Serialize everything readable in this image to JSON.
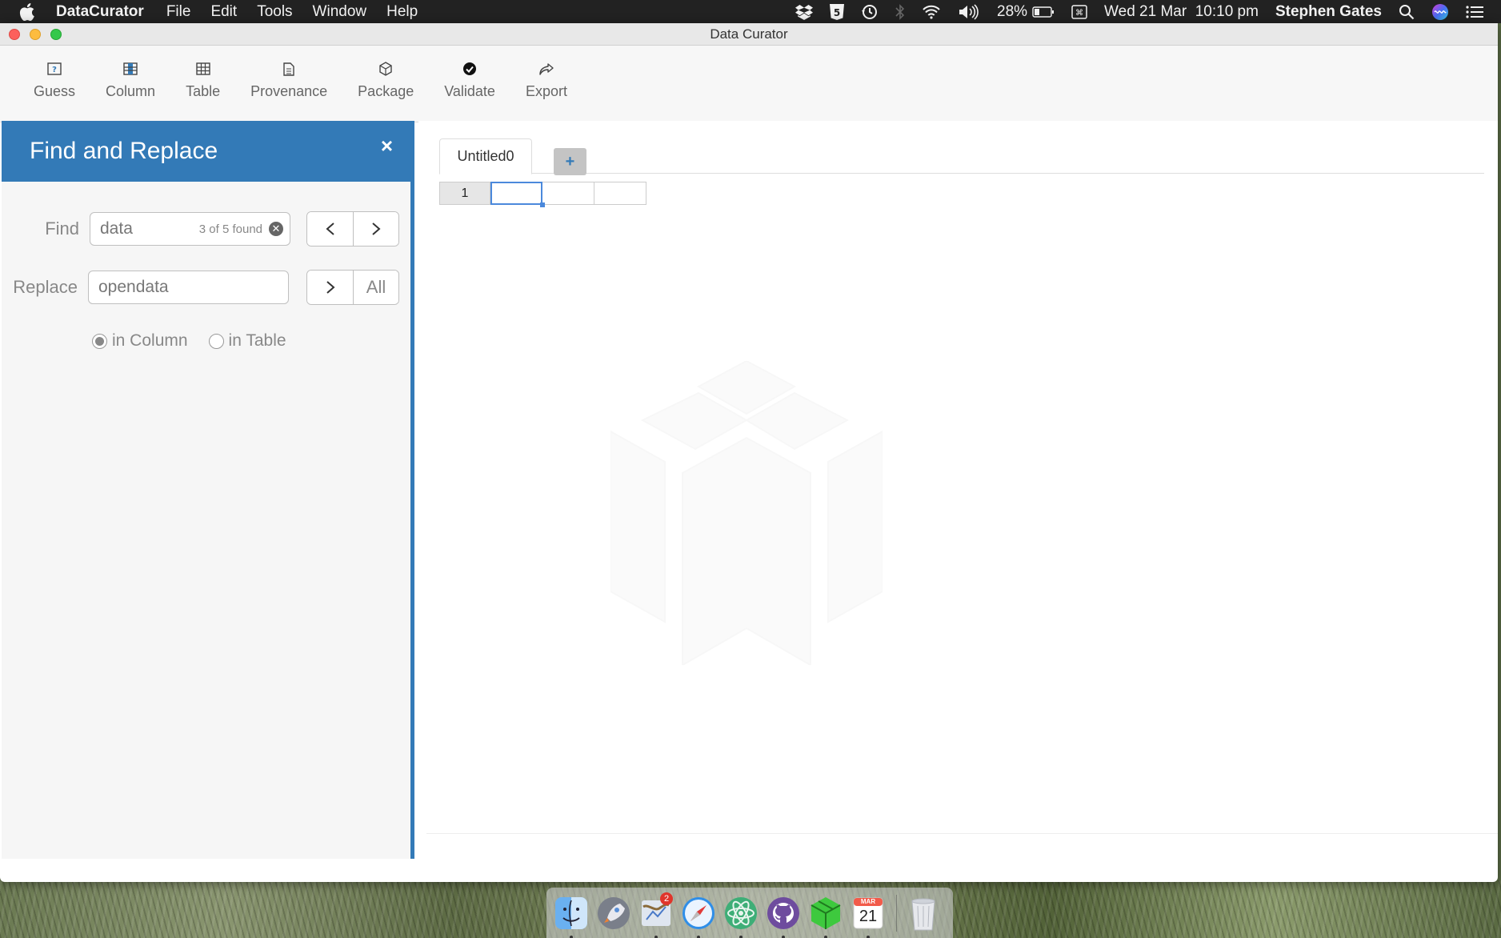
{
  "menubar": {
    "app_name": "DataCurator",
    "menus": [
      "File",
      "Edit",
      "Tools",
      "Window",
      "Help"
    ],
    "battery": "28%",
    "datetime": "Wed 21 Mar  10:10 pm",
    "user": "Stephen Gates"
  },
  "window": {
    "title": "Data Curator"
  },
  "toolbar": {
    "items": [
      {
        "label": "Guess",
        "icon": "guess-icon"
      },
      {
        "label": "Column",
        "icon": "column-icon"
      },
      {
        "label": "Table",
        "icon": "table-icon"
      },
      {
        "label": "Provenance",
        "icon": "document-icon"
      },
      {
        "label": "Package",
        "icon": "package-icon"
      },
      {
        "label": "Validate",
        "icon": "check-circle-icon"
      },
      {
        "label": "Export",
        "icon": "share-icon"
      }
    ]
  },
  "find_replace": {
    "title": "Find and Replace",
    "close": "×",
    "find_label": "Find",
    "find_value": "data",
    "find_count": "3 of 5 found",
    "replace_label": "Replace",
    "replace_value": "opendata",
    "prev_symbol": "<",
    "next_symbol": ">",
    "all_label": "All",
    "scope_options": [
      {
        "label": "in Column",
        "checked": true
      },
      {
        "label": "in Table",
        "checked": false
      }
    ]
  },
  "sheet": {
    "tabs": [
      {
        "label": "Untitled0",
        "active": true
      }
    ],
    "add_tab": "+",
    "row_numbers": [
      "1"
    ]
  },
  "dock": {
    "apps": [
      "finder",
      "launchpad",
      "mail",
      "safari",
      "atom",
      "github-desktop",
      "data-curator",
      "calendar"
    ],
    "mail_badge": "2",
    "calendar_month": "MAR",
    "calendar_day": "21"
  },
  "colors": {
    "accent": "#337ab7",
    "menubar": "#222222",
    "selection": "#4b89dc"
  }
}
